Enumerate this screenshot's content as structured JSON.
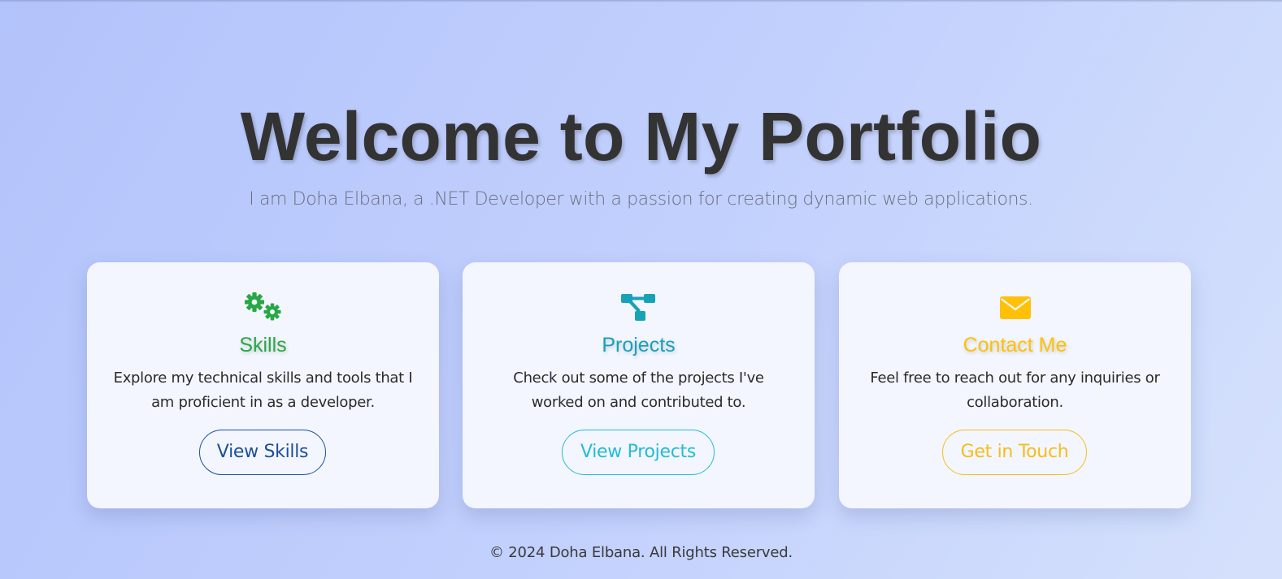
{
  "hero": {
    "title": "Welcome to My Portfolio",
    "subtitle": "I am Doha Elbana, a .NET Developer with a passion for creating dynamic web applications."
  },
  "cards": [
    {
      "icon": "gears-icon",
      "title": "Skills",
      "description": "Explore my technical skills and tools that I am proficient in as a developer.",
      "button_label": "View Skills",
      "accent_color": "#28a745",
      "button_color": "#1b4f9c"
    },
    {
      "icon": "project-diagram-icon",
      "title": "Projects",
      "description": "Check out some of the projects I've worked on and contributed to.",
      "button_label": "View Projects",
      "accent_color": "#17a2b8",
      "button_color": "#22bcd6"
    },
    {
      "icon": "envelope-icon",
      "title": "Contact Me",
      "description": "Feel free to reach out for any inquiries or collaboration.",
      "button_label": "Get in Touch",
      "accent_color": "#ffc107",
      "button_color": "#f5be1a"
    }
  ],
  "footer": {
    "text": "© 2024 Doha Elbana. All Rights Reserved."
  },
  "colors": {
    "heading": "#333333",
    "subtitle": "#6b6f80",
    "background_start": "#b3c3fb",
    "background_end": "#d5e1fc",
    "card_background": "#f3f6fe"
  }
}
